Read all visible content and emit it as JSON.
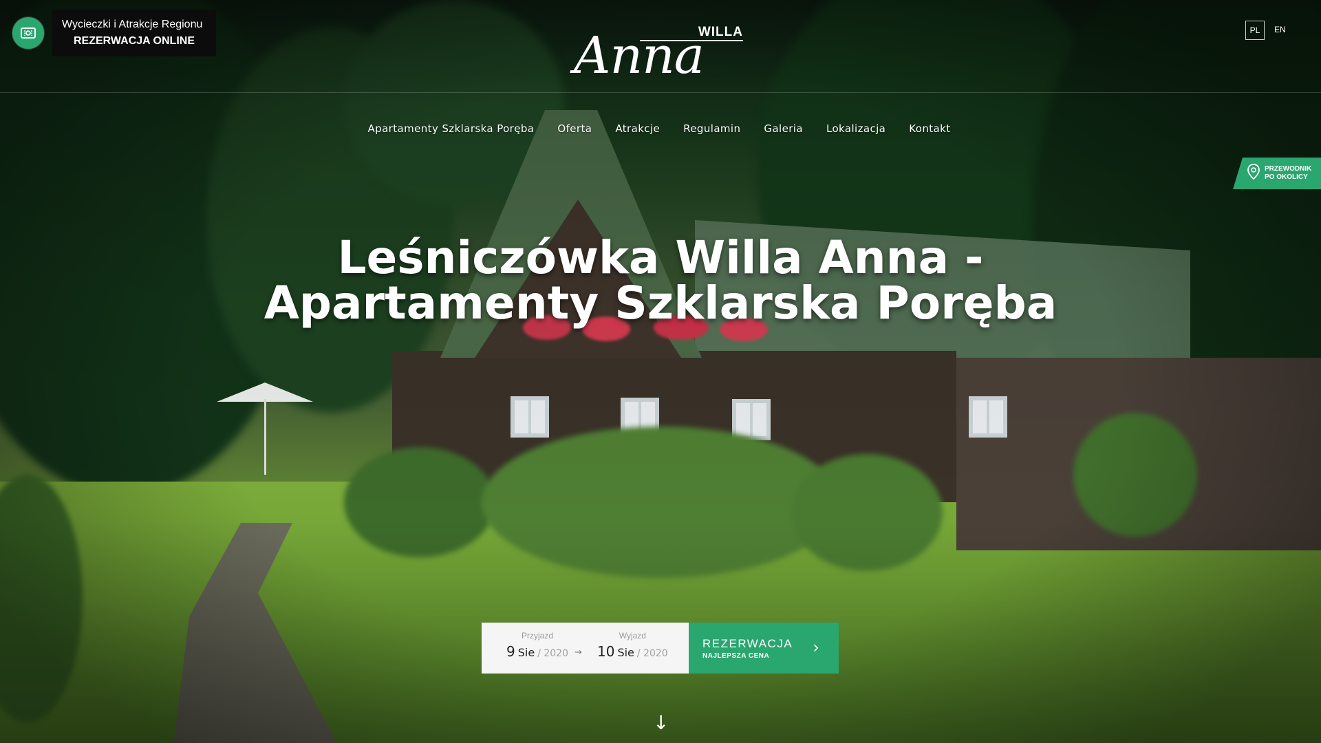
{
  "promo": {
    "line1": "Wycieczki i Atrakcje Regionu",
    "line2": "REZERWACJA ONLINE",
    "icon": "ticket-icon"
  },
  "logo": {
    "willa": "WILLA",
    "anna": "Anna"
  },
  "languages": {
    "pl": "PL",
    "en": "EN"
  },
  "nav": {
    "items": [
      {
        "label": "Apartamenty Szklarska Poręba"
      },
      {
        "label": "Oferta"
      },
      {
        "label": "Atrakcje"
      },
      {
        "label": "Regulamin"
      },
      {
        "label": "Galeria"
      },
      {
        "label": "Lokalizacja"
      },
      {
        "label": "Kontakt"
      }
    ]
  },
  "guide": {
    "line1": "PRZEWODNIK",
    "line2": "PO OKOLICY",
    "icon": "map-pin-icon"
  },
  "hero": {
    "title_line1": "Leśniczówka Willa Anna -",
    "title_line2": "Apartamenty Szklarska Poręba"
  },
  "booking": {
    "arrival": {
      "label": "Przyjazd",
      "day": "9",
      "month": "Sie",
      "year": "/ 2020"
    },
    "departure": {
      "label": "Wyjazd",
      "day": "10",
      "month": "Sie",
      "year": "/ 2020"
    },
    "arrow": "→",
    "button_main": "REZERWACJA",
    "button_sub": "NAJLEPSZA CENA",
    "chevron": "›"
  },
  "scroll": {
    "glyph": "↓"
  },
  "colors": {
    "accent": "#2aa66f",
    "promo_bg": "#0c0c0c",
    "date_bg": "#f5f5f5"
  }
}
